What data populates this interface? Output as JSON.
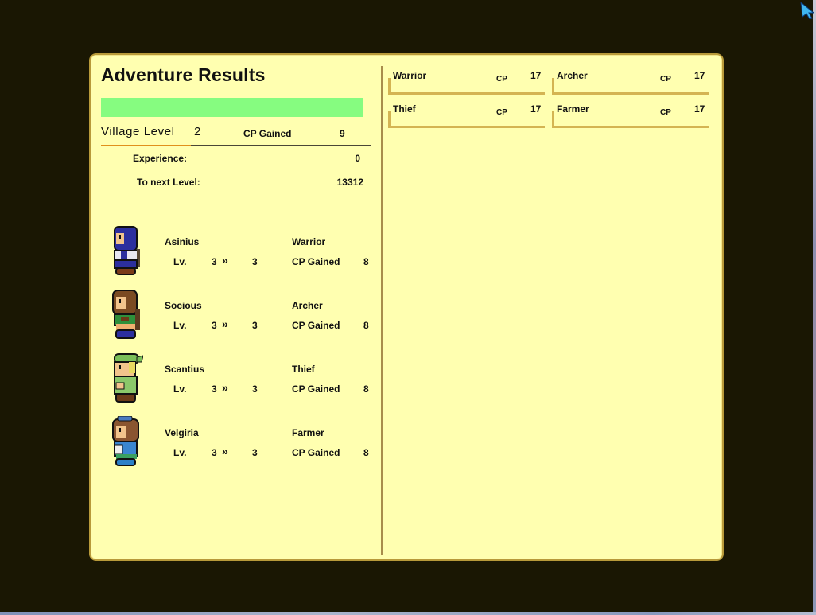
{
  "window": {
    "title": "Adventure Results"
  },
  "progress": {
    "fraction": 1.0,
    "color": "#86fc80"
  },
  "village": {
    "level_label": "Village Level",
    "level_value": "2",
    "cp_label": "CP Gained",
    "cp_value": "9",
    "experience_label": "Experience:",
    "experience_value": "0",
    "next_label": "To next Level:",
    "next_value": "13312"
  },
  "members": [
    {
      "name": "Asinius",
      "lv_label": "Lv.",
      "lv_from": "3",
      "arrow": "»",
      "lv_to": "3",
      "job": "Warrior",
      "cp_label": "CP Gained",
      "cp_value": "8",
      "sprite": "hooded-blue-warrior"
    },
    {
      "name": "Socious",
      "lv_label": "Lv.",
      "lv_from": "3",
      "arrow": "»",
      "lv_to": "3",
      "job": "Archer",
      "cp_label": "CP Gained",
      "cp_value": "8",
      "sprite": "brown-hair-green-archer"
    },
    {
      "name": "Scantius",
      "lv_label": "Lv.",
      "lv_from": "3",
      "arrow": "»",
      "lv_to": "3",
      "job": "Thief",
      "cp_label": "CP Gained",
      "cp_value": "8",
      "sprite": "green-cap-thief"
    },
    {
      "name": "Velgiria",
      "lv_label": "Lv.",
      "lv_from": "3",
      "arrow": "»",
      "lv_to": "3",
      "job": "Farmer",
      "cp_label": "CP Gained",
      "cp_value": "8",
      "sprite": "goggles-blue-farmer"
    }
  ],
  "jobs": [
    {
      "name": "Warrior",
      "cp_label": "CP",
      "cp_value": "17"
    },
    {
      "name": "Archer",
      "cp_label": "CP",
      "cp_value": "17"
    },
    {
      "name": "Thief",
      "cp_label": "CP",
      "cp_value": "17"
    },
    {
      "name": "Farmer",
      "cp_label": "CP",
      "cp_value": "17"
    }
  ],
  "colors": {
    "panel_bg": "#ffffb0",
    "panel_border": "#b89a3a",
    "accent_orange": "#e0901c",
    "screen_bg": "#1a1703"
  }
}
